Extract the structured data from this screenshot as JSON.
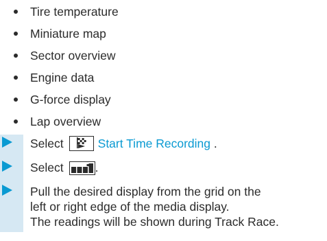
{
  "display_items": [
    "Tire temperature",
    "Miniature map",
    "Sector overview",
    "Engine data",
    "G-force display",
    "Lap overview"
  ],
  "steps": {
    "step1": {
      "prefix": "Select",
      "icon": "checkered-flag-icon",
      "link": "Start Time Recording",
      "suffix": " ."
    },
    "step2": {
      "prefix": "Select",
      "icon": "display-grid-icon",
      "suffix": "."
    },
    "step3": {
      "line1": "Pull the desired display from the grid on the",
      "line2": "left or right edge of the media display.",
      "line3": "The readings will be shown during Track Race."
    }
  },
  "colors": {
    "accent": "#0a9ad2",
    "step_bar": "#d6e8f3",
    "text": "#2b2b2b"
  }
}
